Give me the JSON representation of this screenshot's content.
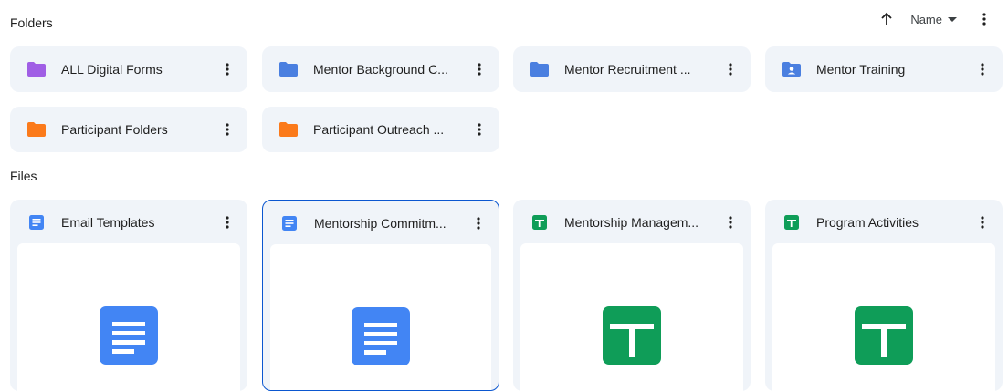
{
  "sections": {
    "folders_title": "Folders",
    "files_title": "Files"
  },
  "toolbar": {
    "sort_label": "Name"
  },
  "colors": {
    "purple": "#a05ee5",
    "blue": "#4a7fe0",
    "orange": "#fb7a1b",
    "docs_blue": "#4285f4",
    "sheets_green": "#0f9d58",
    "selection_blue": "#0b57d0"
  },
  "folders": [
    {
      "label": "ALL Digital Forms",
      "icon": "folder-icon",
      "color": "purple"
    },
    {
      "label": "Mentor Background C...",
      "icon": "folder-icon",
      "color": "blue"
    },
    {
      "label": "Mentor Recruitment ...",
      "icon": "folder-icon",
      "color": "blue"
    },
    {
      "label": "Mentor Training",
      "icon": "shared-folder-icon",
      "color": "blue"
    },
    {
      "label": "Participant Folders",
      "icon": "folder-icon",
      "color": "orange"
    },
    {
      "label": "Participant Outreach ...",
      "icon": "folder-icon",
      "color": "orange"
    }
  ],
  "files": [
    {
      "label": "Email Templates",
      "type": "google-docs",
      "selected": false
    },
    {
      "label": "Mentorship Commitm...",
      "type": "google-docs",
      "selected": true
    },
    {
      "label": "Mentorship Managem...",
      "type": "google-sheets",
      "selected": false
    },
    {
      "label": "Program Activities",
      "type": "google-sheets",
      "selected": false
    }
  ]
}
